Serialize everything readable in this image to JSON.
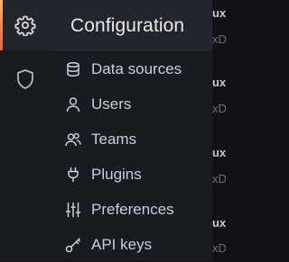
{
  "sidebar": {
    "items": [
      {
        "icon": "gear-icon",
        "active": true
      },
      {
        "icon": "shield-icon",
        "active": false
      }
    ]
  },
  "menu": {
    "title": "Configuration",
    "items": [
      {
        "label": "Data sources",
        "icon": "database-icon"
      },
      {
        "label": "Users",
        "icon": "user-icon"
      },
      {
        "label": "Teams",
        "icon": "users-icon"
      },
      {
        "label": "Plugins",
        "icon": "plug-icon"
      },
      {
        "label": "Preferences",
        "icon": "sliders-icon"
      },
      {
        "label": "API keys",
        "icon": "key-icon"
      }
    ]
  },
  "background": {
    "fragments": [
      "ux",
      "xD",
      "ux",
      "xD",
      "ux",
      "xD",
      "ux",
      "xD"
    ]
  },
  "colors": {
    "accent_start": "#ffb357",
    "accent_end": "#f55f3e",
    "panel": "#181b1f",
    "header": "#22252b"
  }
}
